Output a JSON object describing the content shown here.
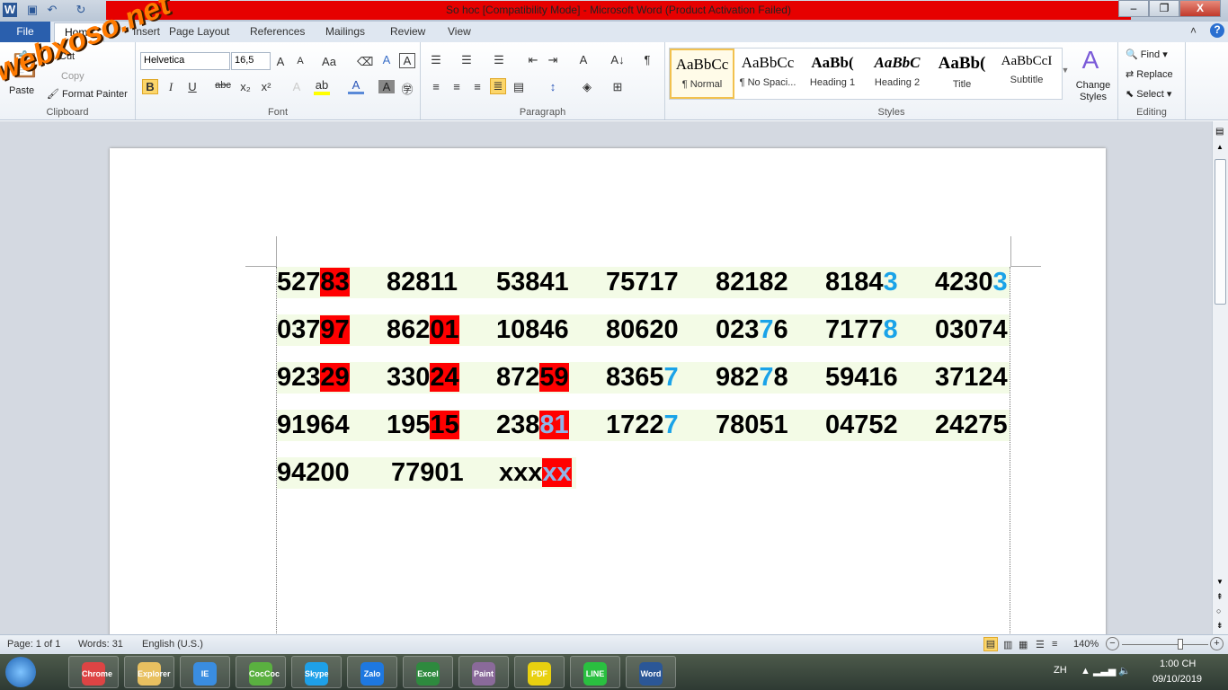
{
  "window": {
    "title": "So hoc [Compatibility Mode]  -  Microsoft Word (Product Activation Failed)"
  },
  "tabs": [
    "File",
    "Home",
    "Insert",
    "Page Layout",
    "References",
    "Mailings",
    "Review",
    "View"
  ],
  "clipboard": {
    "paste": "Paste",
    "cut": "Cut",
    "copy": "Copy",
    "format_painter": "Format Painter",
    "label": "Clipboard"
  },
  "font": {
    "name": "Helvetica",
    "size": "16,5",
    "label": "Font"
  },
  "paragraph": {
    "label": "Paragraph"
  },
  "styles": {
    "items": [
      {
        "preview": "AaBbCc",
        "name": "¶ Normal"
      },
      {
        "preview": "AaBbCc",
        "name": "¶ No Spaci..."
      },
      {
        "preview": "AaBb(",
        "name": "Heading 1"
      },
      {
        "preview": "AaBbC",
        "name": "Heading 2"
      },
      {
        "preview": "AaBb(",
        "name": "Title"
      },
      {
        "preview": "AaBbCcI",
        "name": "Subtitle"
      }
    ],
    "change": "Change Styles",
    "label": "Styles"
  },
  "editing": {
    "find": "Find",
    "replace": "Replace",
    "select": "Select",
    "label": "Editing"
  },
  "watermark": "webxoso.net",
  "document": {
    "rows": [
      [
        [
          [
            "527",
            "n"
          ],
          [
            "83",
            "r"
          ]
        ],
        [
          [
            "82811",
            "n"
          ]
        ],
        [
          [
            "53841",
            "n"
          ]
        ],
        [
          [
            "75717",
            "n"
          ]
        ],
        [
          [
            "82182",
            "n"
          ]
        ],
        [
          [
            "8184",
            "n"
          ],
          [
            "3",
            "b"
          ]
        ],
        [
          [
            "4230",
            "n"
          ],
          [
            "3",
            "b"
          ]
        ]
      ],
      [
        [
          [
            "037",
            "n"
          ],
          [
            "97",
            "r"
          ]
        ],
        [
          [
            "862",
            "n"
          ],
          [
            "01",
            "r"
          ]
        ],
        [
          [
            "10846",
            "n"
          ]
        ],
        [
          [
            "80620",
            "n"
          ]
        ],
        [
          [
            "023",
            "n"
          ],
          [
            "7",
            "b"
          ],
          [
            "6",
            "n"
          ]
        ],
        [
          [
            "7177",
            "n"
          ],
          [
            "8",
            "b"
          ]
        ],
        [
          [
            "03074",
            "n"
          ]
        ]
      ],
      [
        [
          [
            "923",
            "n"
          ],
          [
            "29",
            "r"
          ]
        ],
        [
          [
            "330",
            "n"
          ],
          [
            "24",
            "r"
          ]
        ],
        [
          [
            "872",
            "n"
          ],
          [
            "59",
            "r"
          ]
        ],
        [
          [
            "8365",
            "n"
          ],
          [
            "7",
            "b"
          ]
        ],
        [
          [
            "982",
            "n"
          ],
          [
            "7",
            "b"
          ],
          [
            "8",
            "n"
          ]
        ],
        [
          [
            "59416",
            "n"
          ]
        ],
        [
          [
            "37124",
            "n"
          ]
        ]
      ],
      [
        [
          [
            "91964",
            "n"
          ]
        ],
        [
          [
            "195",
            "n"
          ],
          [
            "15",
            "r"
          ]
        ],
        [
          [
            "238",
            "n"
          ],
          [
            "81",
            "rb"
          ]
        ],
        [
          [
            "1722",
            "n"
          ],
          [
            "7",
            "b"
          ]
        ],
        [
          [
            "78051",
            "n"
          ]
        ],
        [
          [
            "04752",
            "n"
          ]
        ],
        [
          [
            "24275",
            "n"
          ]
        ]
      ],
      [
        [
          [
            "94200",
            "n"
          ]
        ],
        [
          [
            "77901",
            "n"
          ]
        ],
        [
          [
            "xxx",
            "n"
          ],
          [
            "xx",
            "rb"
          ]
        ]
      ]
    ]
  },
  "status": {
    "page": "Page: 1 of 1",
    "words": "Words: 31",
    "language": "English (U.S.)",
    "zoom": "140%",
    "zoom_percent": 140
  },
  "taskbar": {
    "apps": [
      "Chrome",
      "Explorer",
      "IE",
      "CocCoc",
      "Skype",
      "Zalo",
      "Excel",
      "Paint",
      "PDF",
      "LINE",
      "Word"
    ],
    "lang": "ZH",
    "time": "1:00 CH",
    "date": "09/10/2019"
  }
}
